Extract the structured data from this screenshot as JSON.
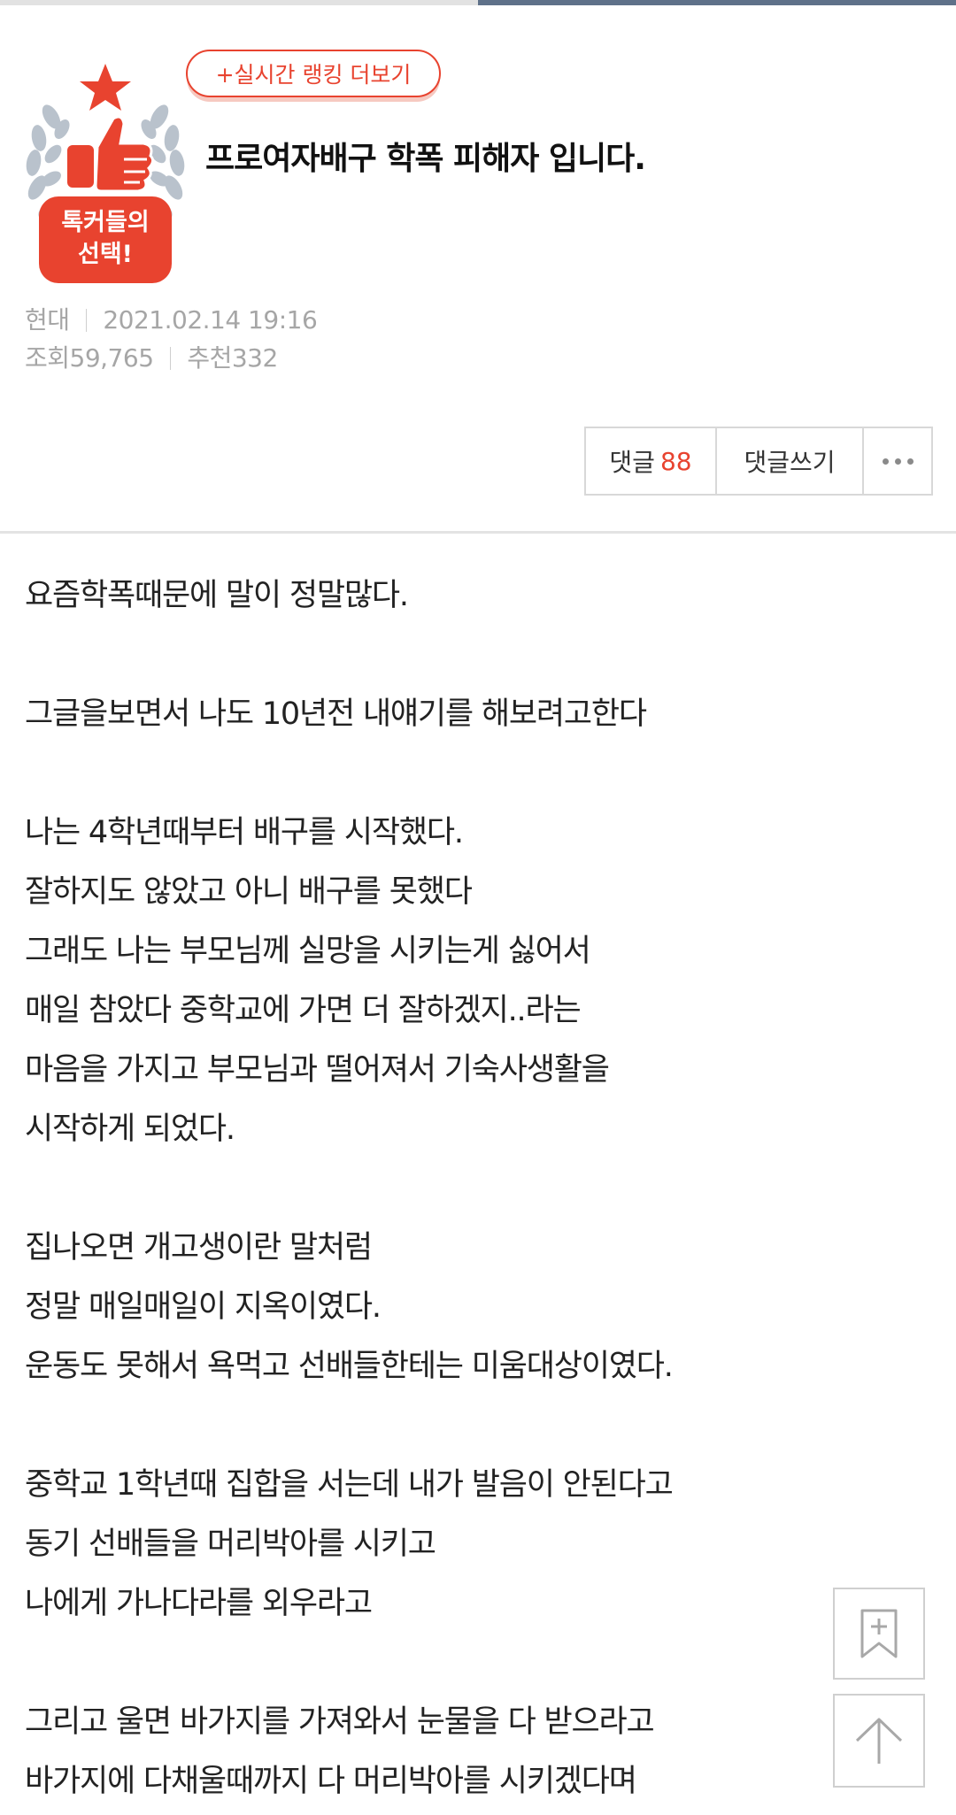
{
  "header": {
    "ranking_button": "+실시간 랭킹 더보기",
    "badge_line1": "톡커들의",
    "badge_line2": "선택!",
    "title": "프로여자배구 학폭 피해자 입니다."
  },
  "meta": {
    "author": "현대",
    "datetime": "2021.02.14 19:16",
    "views_label": "조회",
    "views": "59,765",
    "recommend_label": "추천",
    "recommend": "332"
  },
  "actions": {
    "comments_label": "댓글",
    "comments_count": "88",
    "write_comment": "댓글쓰기",
    "more_icon": "more-dots-icon"
  },
  "body_lines": [
    "요즘학폭때문에 말이 정말많다.",
    "",
    "그글을보면서 나도 10년전 내얘기를 해보려고한다",
    "",
    "나는 4학년때부터 배구를 시작했다.",
    "잘하지도 않았고 아니 배구를 못했다",
    "그래도 나는 부모님께 실망을 시키는게 싫어서",
    "매일 참았다 중학교에 가면 더 잘하겠지..라는",
    "마음을 가지고 부모님과 떨어져서 기숙사생활을",
    "시작하게 되었다.",
    "",
    "집나오면 개고생이란 말처럼",
    "정말 매일매일이 지옥이였다.",
    "운동도 못해서 욕먹고 선배들한테는 미움대상이였다.",
    "",
    "중학교 1학년때 집합을 서는데 내가 발음이 안된다고",
    "동기 선배들을 머리박아를 시키고",
    "나에게 가나다라를 외우라고",
    "",
    "그리고 울면 바가지를 가져와서 눈물을 다 받으라고",
    "바가지에 다채울때까지 다 머리박아를 시키겠다며"
  ],
  "colors": {
    "accent": "#e8432f",
    "meta_gray": "#a6a6a6",
    "progress": "#5f7189"
  },
  "scroll_progress": 0.5,
  "floating": {
    "bookmark_icon": "bookmark-add-icon",
    "top_icon": "arrow-up-icon"
  }
}
